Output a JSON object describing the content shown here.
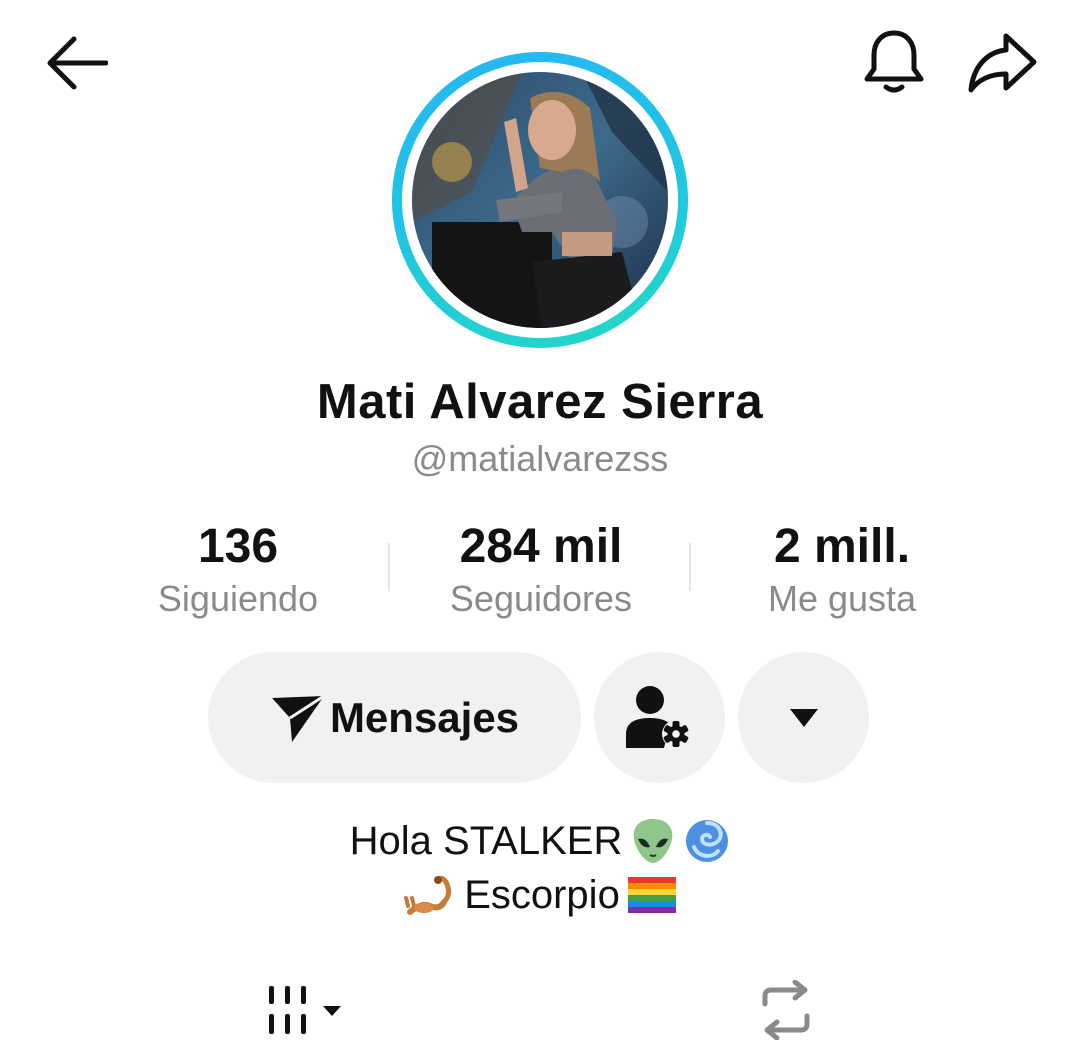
{
  "header": {
    "back_icon": "arrow-left-icon",
    "notification_icon": "bell-icon",
    "share_icon": "share-arrow-icon"
  },
  "profile": {
    "display_name": "Mati Alvarez Sierra",
    "username": "@matialvarezss",
    "avatar_ring_colors": [
      "#27b7f2",
      "#23d9c5"
    ]
  },
  "stats": [
    {
      "value": "136",
      "label": "Siguiendo"
    },
    {
      "value": "284 mil",
      "label": "Seguidores"
    },
    {
      "value": "2 mill.",
      "label": "Me gusta"
    }
  ],
  "actions": {
    "message_label": "Mensajes",
    "message_icon": "send-icon",
    "friend_settings_icon": "person-gear-icon",
    "more_icon": "triangle-down-icon"
  },
  "bio": {
    "line1_text": "Hola STALKER",
    "line1_emojis": [
      "alien-emoji",
      "cyclone-emoji"
    ],
    "line2_text": "Escorpio",
    "line2_emojis": [
      "scorpion-emoji",
      "rainbow-flag-emoji"
    ]
  },
  "tabs": [
    {
      "icon": "video-grid-icon",
      "has_dropdown": true
    },
    {
      "icon": "repost-icon",
      "has_dropdown": false
    }
  ]
}
